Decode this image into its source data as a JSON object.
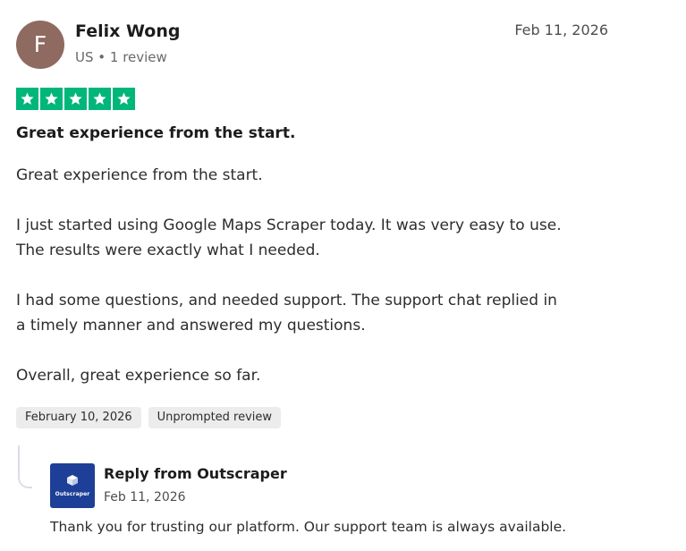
{
  "reviewer": {
    "initial": "F",
    "name": "Felix Wong",
    "meta": "US • 1 review",
    "avatar_color": "#8f6a61"
  },
  "review": {
    "date": "Feb 11, 2026",
    "rating": 5,
    "rating_max": 5,
    "star_color": "#00b67a",
    "title": "Great experience from the start.",
    "paragraphs": [
      "Great experience from the start.",
      "I just started using Google Maps Scraper today. It was very easy to use. The results were exactly what I needed.",
      "I had some questions, and needed support. The support chat replied in a timely manner and answered my questions.",
      "Overall, great experience so far."
    ],
    "paragraph_lines": [
      [
        "Great experience from the start."
      ],
      [
        "I just started using Google Maps Scraper today. It was very easy to use.",
        "The results were exactly what I needed."
      ],
      [
        "I had some questions, and needed support. The support chat replied in",
        "a timely manner and answered my questions."
      ],
      [
        "Overall, great experience so far."
      ]
    ],
    "tags": [
      "February 10, 2026",
      "Unprompted review"
    ]
  },
  "reply": {
    "title": "Reply from Outscraper",
    "date": "Feb 11, 2026",
    "text": "Thank you for trusting our platform. Our support team is always available.",
    "logo_text": "Outscraper",
    "logo_color": "#1e3f97"
  }
}
